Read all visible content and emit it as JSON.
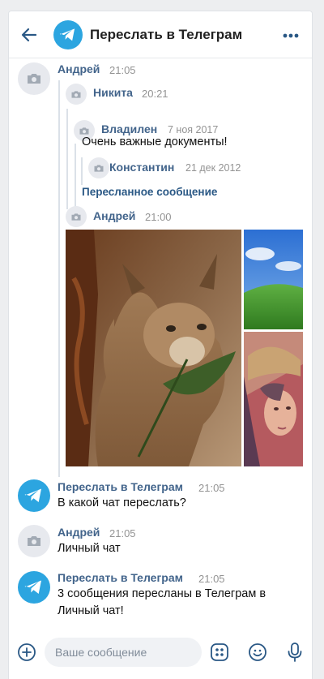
{
  "header": {
    "title": "Переслать в Телеграм",
    "back_icon": "arrow-left-icon",
    "more_icon": "more-dots-icon",
    "avatar_icon": "telegram-icon"
  },
  "messages": [
    {
      "author": "Андрей",
      "time": "21:05",
      "forwarded": [
        {
          "author": "Никита",
          "time": "20:21",
          "forwarded": [
            {
              "author": "Владилен",
              "time": "7 ноя 2017",
              "text": "Очень важные документы!",
              "forwarded": [
                {
                  "author": "Константин",
                  "time": "21 дек 2012"
                }
              ],
              "fwd_link": "Пересланное сообщение"
            }
          ]
        },
        {
          "author": "Андрей",
          "time": "21:00",
          "photos": [
            "caracal-photo",
            "windows-bliss-photo",
            "lena-portrait-photo"
          ]
        }
      ]
    },
    {
      "author": "Переслать в Телеграм",
      "time": "21:05",
      "text": "В какой чат переслать?"
    },
    {
      "author": "Андрей",
      "time": "21:05",
      "text": "Личный чат"
    },
    {
      "author": "Переслать в Телеграм",
      "time": "21:05",
      "text_line1": "3 сообщения пересланы в Телеграм в",
      "text_line2": "Личный чат!"
    }
  ],
  "composer": {
    "placeholder": "Ваше сообщение",
    "icons": [
      "plus-circle-icon",
      "keyboard-bot-icon",
      "smile-icon",
      "microphone-icon"
    ]
  },
  "colors": {
    "accent": "#2a5885",
    "author": "#42648b",
    "telegram": "#2ca5e0"
  }
}
